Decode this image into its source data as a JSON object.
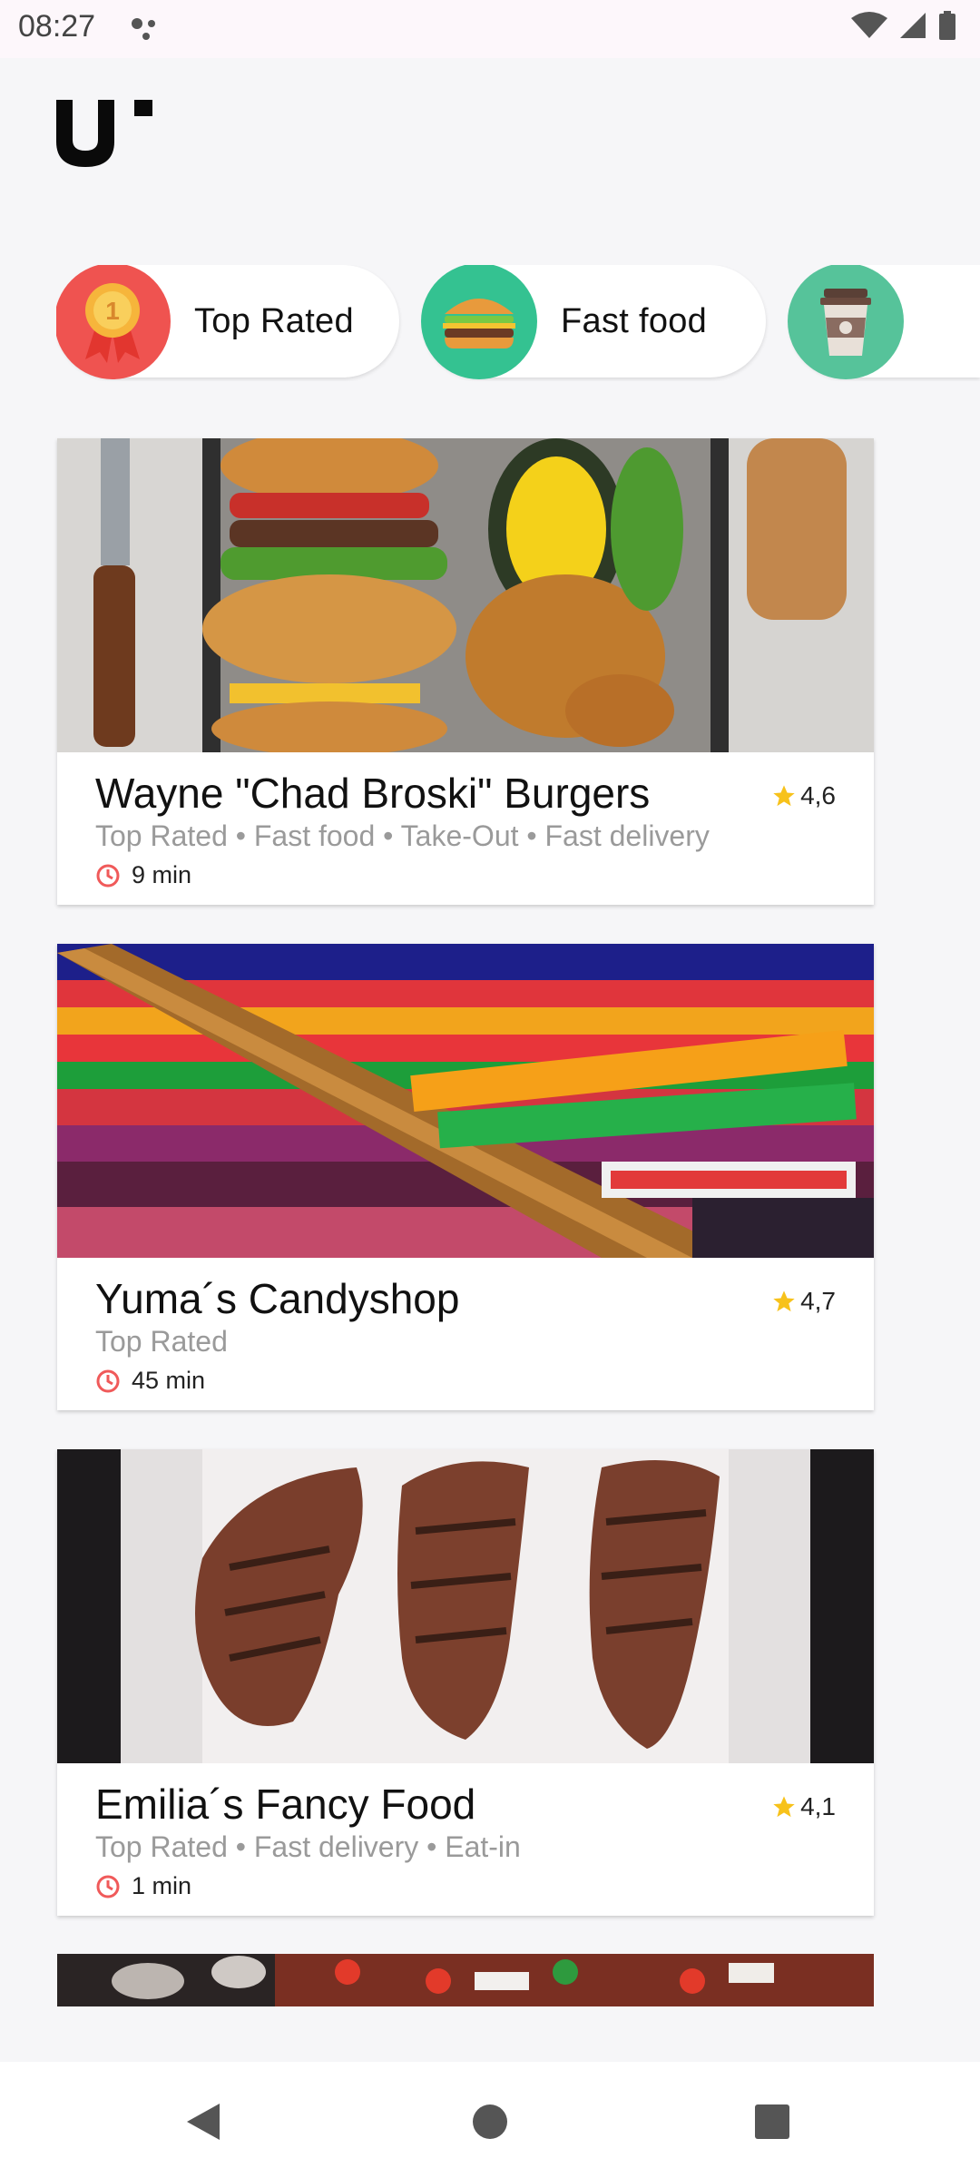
{
  "status_bar": {
    "time": "08:27"
  },
  "app": {
    "logo_text": "U"
  },
  "categories": [
    {
      "label": "Top Rated",
      "icon": "medal-icon",
      "color": "#ef5350"
    },
    {
      "label": "Fast food",
      "icon": "burger-icon",
      "color": "#34c291"
    },
    {
      "label": "",
      "icon": "coffee-cup-icon",
      "color": "#56c39a"
    }
  ],
  "restaurants": [
    {
      "name": "Wayne \"Chad Broski\" Burgers",
      "tags": "Top Rated • Fast food • Take-Out • Fast delivery",
      "time": "9 min",
      "rating": "4,6"
    },
    {
      "name": "Yuma´s Candyshop",
      "tags": "Top Rated",
      "time": "45 min",
      "rating": "4,7"
    },
    {
      "name": "Emilia´s Fancy Food",
      "tags": "Top Rated • Fast delivery • Eat-in",
      "time": "1 min",
      "rating": "4,1"
    }
  ],
  "colors": {
    "accent_star": "#f7c21b",
    "clock": "#f05a5a",
    "background": "#f6f6f8"
  }
}
